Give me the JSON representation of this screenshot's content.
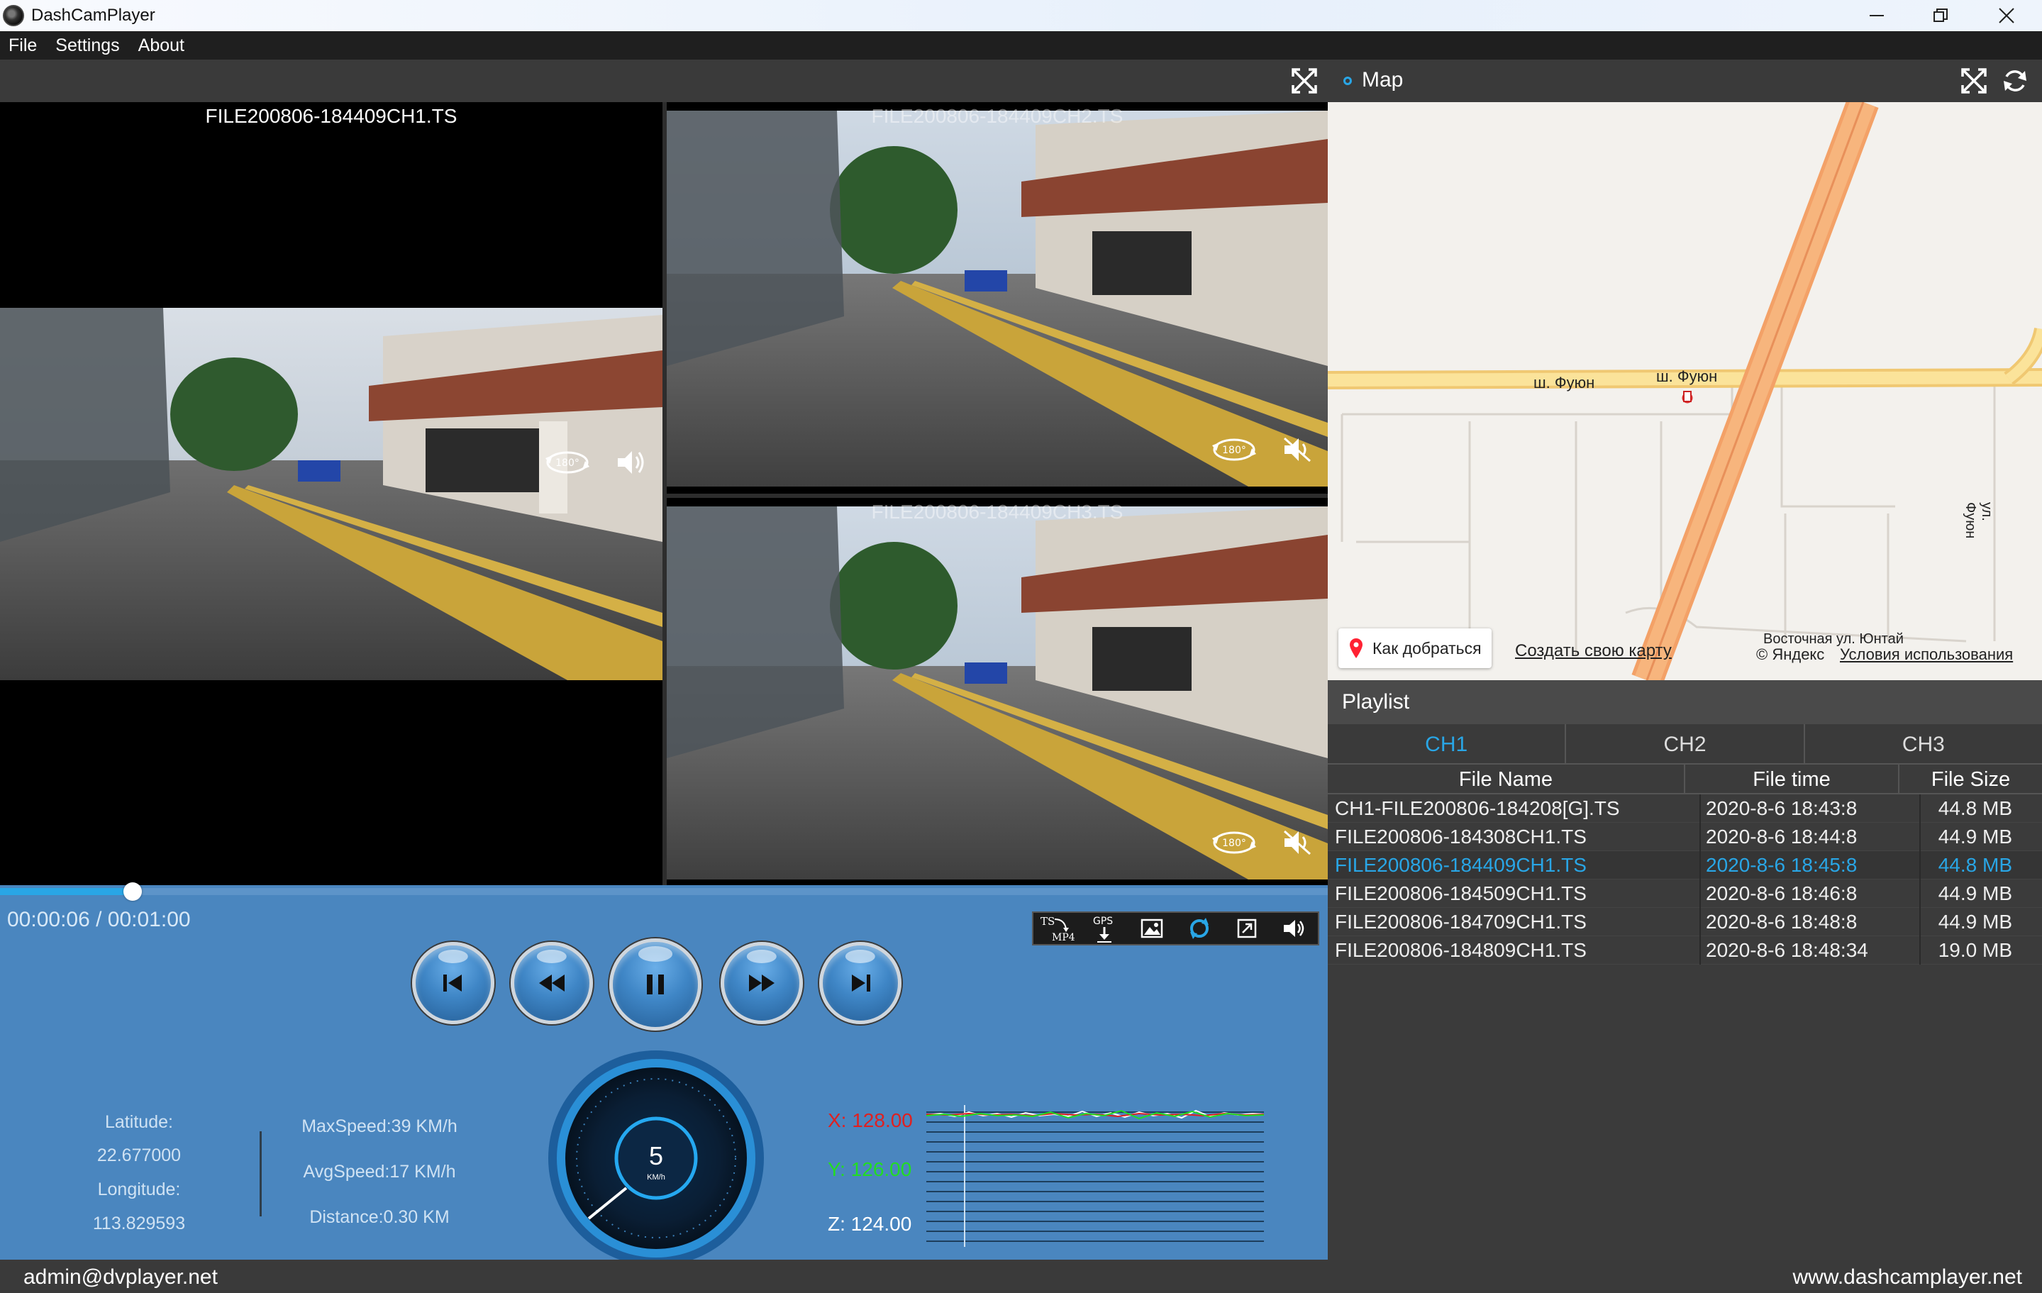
{
  "window": {
    "title": "DashCamPlayer",
    "minimize_icon": "minimize-icon",
    "restore_icon": "restore-icon",
    "close_icon": "close-icon"
  },
  "menu": [
    "File",
    "Settings",
    "About"
  ],
  "panes": {
    "ch1_title": "FILE200806-184409CH1.TS",
    "ch2_title": "FILE200806-184409CH2.TS",
    "ch3_title": "FILE200806-184409CH3.TS"
  },
  "playback": {
    "time": "00:00:06 / 00:01:00",
    "progress": 0.1,
    "tools": [
      "TS MP4",
      "GPS",
      "snapshot",
      "sync",
      "fullscreen",
      "volume"
    ]
  },
  "gps": {
    "latitude_label": "Latitude:",
    "latitude": "22.677000",
    "longitude_label": "Longitude:",
    "longitude": "113.829593",
    "max_speed": "MaxSpeed:39 KM/h",
    "avg_speed": "AvgSpeed:17 KM/h",
    "distance": "Distance:0.30 KM",
    "speed": "5",
    "speed_unit": "KM/h"
  },
  "gsensor": {
    "x_label": "X: 128.00",
    "y_label": "Y: 126.00",
    "z_label": "Z: 124.00",
    "x_color": "#e02020",
    "y_color": "#22dd22",
    "z_color": "#ffffff"
  },
  "map": {
    "title": "Map",
    "road_label_1": "ш. Фуюн",
    "road_label_2": "ш. Фуюн",
    "road_label_3": "ул. Фуюн",
    "street_label": "Восточная ул. Юнтай",
    "route_button": "Как добраться",
    "create_link": "Создать свою карту",
    "copyright": "© Яндекс",
    "terms_link": "Условия использования"
  },
  "playlist": {
    "title": "Playlist",
    "tabs": [
      "CH1",
      "CH2",
      "CH3"
    ],
    "headers": [
      "File Name",
      "File time",
      "File Size"
    ],
    "rows": [
      {
        "name": "CH1-FILE200806-184208[G].TS",
        "time": "2020-8-6 18:43:8",
        "size": "44.8 MB"
      },
      {
        "name": "FILE200806-184308CH1.TS",
        "time": "2020-8-6 18:44:8",
        "size": "44.9 MB"
      },
      {
        "name": "FILE200806-184409CH1.TS",
        "time": "2020-8-6 18:45:8",
        "size": "44.8 MB"
      },
      {
        "name": "FILE200806-184509CH1.TS",
        "time": "2020-8-6 18:46:8",
        "size": "44.9 MB"
      },
      {
        "name": "FILE200806-184709CH1.TS",
        "time": "2020-8-6 18:48:8",
        "size": "44.9 MB"
      },
      {
        "name": "FILE200806-184809CH1.TS",
        "time": "2020-8-6 18:48:34",
        "size": "19.0 MB"
      }
    ]
  },
  "status": {
    "left": "admin@dvplayer.net",
    "right": "www.dashcamplayer.net"
  }
}
